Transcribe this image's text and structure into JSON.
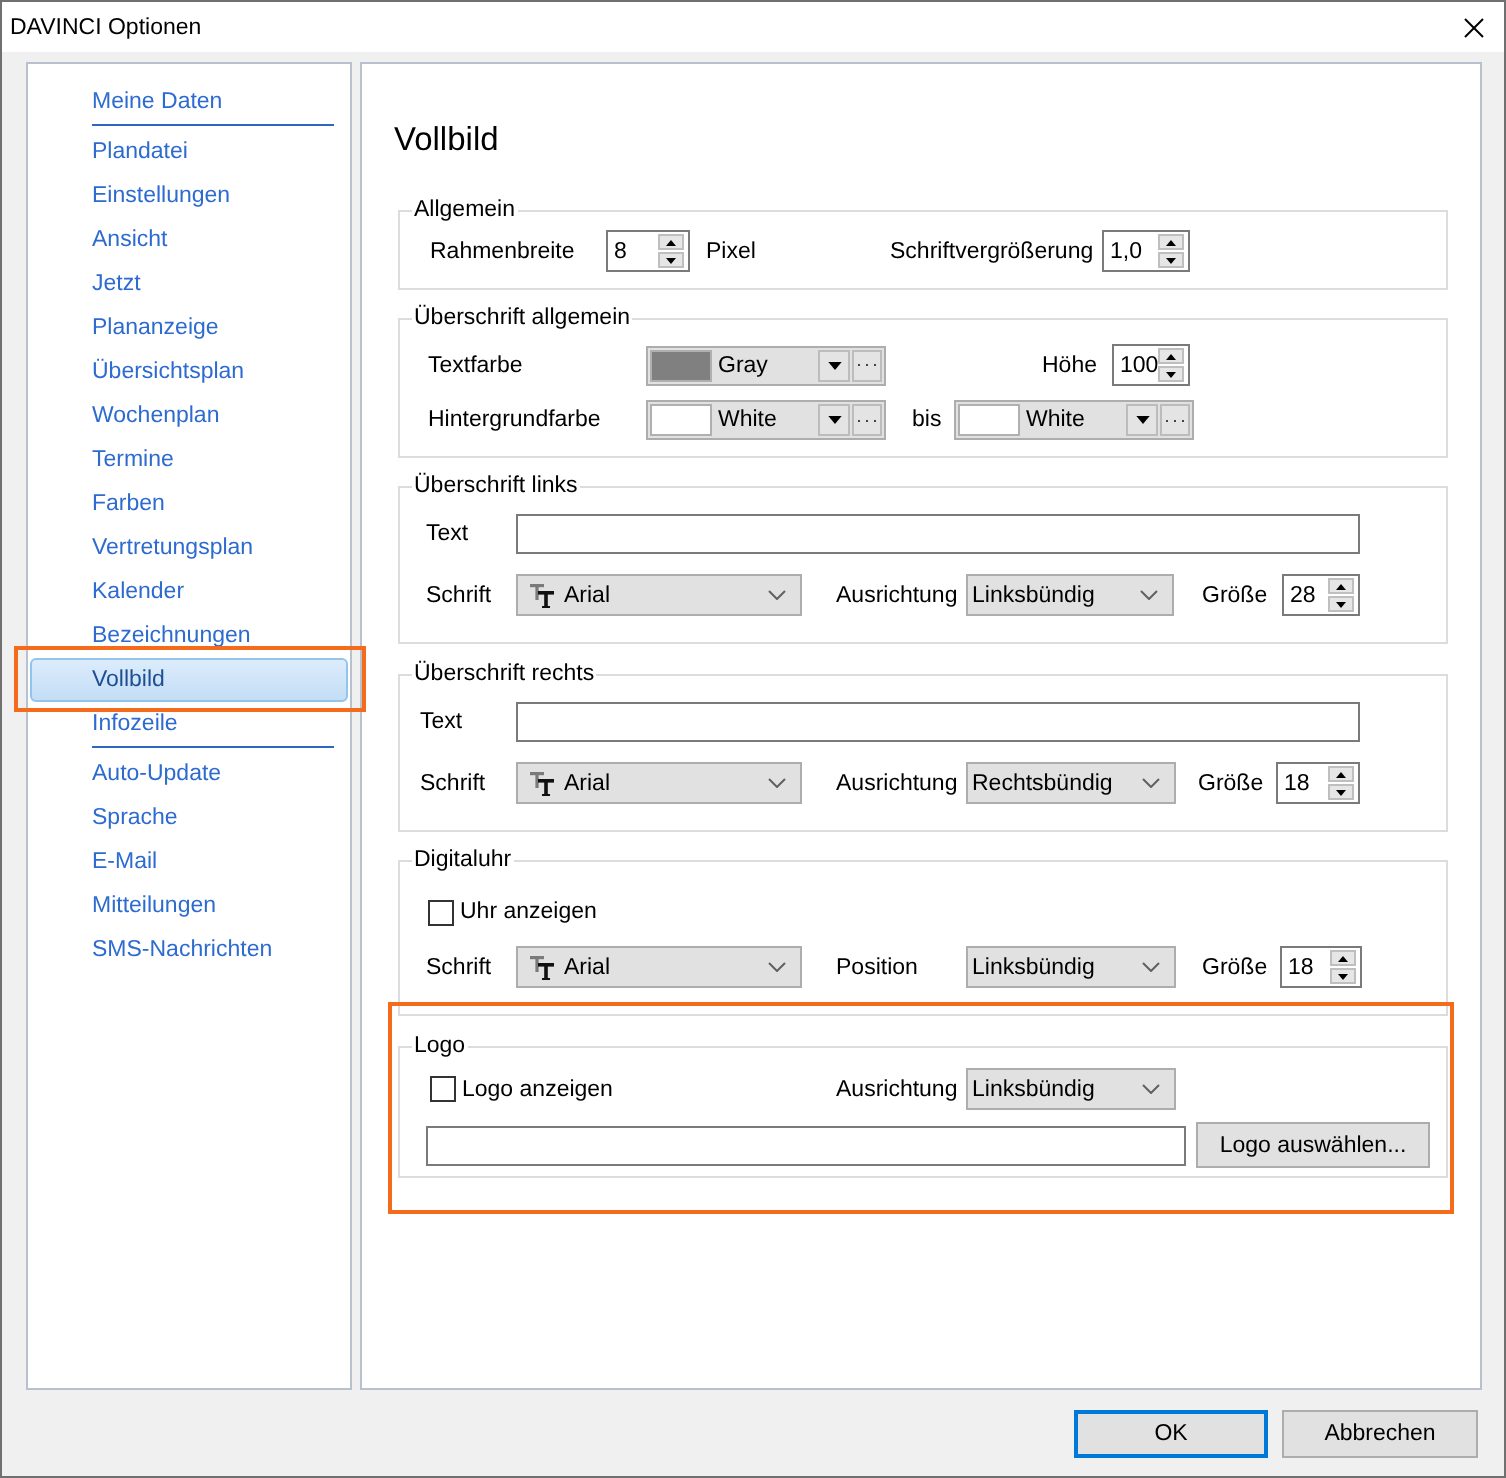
{
  "window": {
    "title": "DAVINCI Optionen"
  },
  "sidebar": {
    "sections": [
      {
        "items": [
          {
            "label": "Meine Daten",
            "selected": false,
            "highlighted": false
          }
        ]
      },
      {
        "items": [
          {
            "label": "Plandatei",
            "selected": false,
            "highlighted": false
          },
          {
            "label": "Einstellungen",
            "selected": false,
            "highlighted": false
          },
          {
            "label": "Ansicht",
            "selected": false,
            "highlighted": false
          },
          {
            "label": "Jetzt",
            "selected": false,
            "highlighted": false
          },
          {
            "label": "Plananzeige",
            "selected": false,
            "highlighted": false
          },
          {
            "label": "Übersichtsplan",
            "selected": false,
            "highlighted": false
          },
          {
            "label": "Wochenplan",
            "selected": false,
            "highlighted": false
          },
          {
            "label": "Termine",
            "selected": false,
            "highlighted": false
          },
          {
            "label": "Farben",
            "selected": false,
            "highlighted": false
          },
          {
            "label": "Vertretungsplan",
            "selected": false,
            "highlighted": false
          },
          {
            "label": "Kalender",
            "selected": false,
            "highlighted": false
          },
          {
            "label": "Bezeichnungen",
            "selected": false,
            "highlighted": false
          },
          {
            "label": "Vollbild",
            "selected": true,
            "highlighted": true
          },
          {
            "label": "Infozeile",
            "selected": false,
            "highlighted": false
          }
        ]
      },
      {
        "items": [
          {
            "label": "Auto-Update",
            "selected": false,
            "highlighted": false
          },
          {
            "label": "Sprache",
            "selected": false,
            "highlighted": false
          },
          {
            "label": "E-Mail",
            "selected": false,
            "highlighted": false
          },
          {
            "label": "Mitteilungen",
            "selected": false,
            "highlighted": false
          },
          {
            "label": "SMS-Nachrichten",
            "selected": false,
            "highlighted": false
          }
        ]
      }
    ]
  },
  "content": {
    "title": "Vollbild",
    "groups": [
      {
        "title": "Allgemein",
        "highlighted": false,
        "lines": [
          {
            "fields": [
              {
                "kind": "label",
                "text": "Rahmenbreite"
              },
              {
                "kind": "spinner",
                "value": "8"
              },
              {
                "kind": "label",
                "text": "Pixel"
              },
              {
                "kind": "label",
                "text": "Schriftvergrößerung"
              },
              {
                "kind": "spinner",
                "value": "1,0"
              }
            ]
          }
        ]
      },
      {
        "title": "Überschrift allgemein",
        "highlighted": false,
        "lines": [
          {
            "fields": [
              {
                "kind": "label",
                "text": "Textfarbe"
              },
              {
                "kind": "color_combo",
                "value": "Gray",
                "color": "#808080"
              },
              {
                "kind": "label",
                "text": "Höhe"
              },
              {
                "kind": "spinner",
                "value": "100"
              }
            ]
          },
          {
            "fields": [
              {
                "kind": "label",
                "text": "Hintergrundfarbe"
              },
              {
                "kind": "color_combo",
                "value": "White",
                "color": "#ffffff"
              },
              {
                "kind": "label",
                "text": "bis"
              },
              {
                "kind": "color_combo",
                "value": "White",
                "color": "#ffffff"
              }
            ]
          }
        ]
      },
      {
        "title": "Überschrift links",
        "highlighted": false,
        "lines": [
          {
            "fields": [
              {
                "kind": "label",
                "text": "Text"
              },
              {
                "kind": "text_input"
              }
            ]
          },
          {
            "fields": [
              {
                "kind": "label",
                "text": "Schrift"
              },
              {
                "kind": "font_combo",
                "value": "Arial"
              },
              {
                "kind": "label",
                "text": "Ausrichtung"
              },
              {
                "kind": "combo",
                "value": "Linksbündig"
              },
              {
                "kind": "label",
                "text": "Größe"
              },
              {
                "kind": "spinner",
                "value": "28"
              }
            ]
          }
        ]
      },
      {
        "title": "Überschrift rechts",
        "highlighted": false,
        "lines": [
          {
            "fields": [
              {
                "kind": "label",
                "text": "Text"
              },
              {
                "kind": "text_input"
              }
            ]
          },
          {
            "fields": [
              {
                "kind": "label",
                "text": "Schrift"
              },
              {
                "kind": "font_combo",
                "value": "Arial"
              },
              {
                "kind": "label",
                "text": "Ausrichtung"
              },
              {
                "kind": "combo",
                "value": "Rechtsbündig"
              },
              {
                "kind": "label",
                "text": "Größe"
              },
              {
                "kind": "spinner",
                "value": "18"
              }
            ]
          }
        ]
      },
      {
        "title": "Digitaluhr",
        "highlighted": false,
        "lines": [
          {
            "fields": [
              {
                "kind": "checkbox",
                "label": "Uhr anzeigen",
                "checked": false
              }
            ]
          },
          {
            "fields": [
              {
                "kind": "label",
                "text": "Schrift"
              },
              {
                "kind": "font_combo",
                "value": "Arial"
              },
              {
                "kind": "label",
                "text": "Position"
              },
              {
                "kind": "combo",
                "value": "Linksbündig"
              },
              {
                "kind": "label",
                "text": "Größe"
              },
              {
                "kind": "spinner",
                "value": "18"
              }
            ]
          }
        ]
      },
      {
        "title": "Logo",
        "highlighted": true,
        "lines": [
          {
            "fields": [
              {
                "kind": "checkbox",
                "label": "Logo anzeigen",
                "checked": false
              },
              {
                "kind": "label",
                "text": "Ausrichtung"
              },
              {
                "kind": "combo",
                "value": "Linksbündig"
              }
            ]
          },
          {
            "fields": [
              {
                "kind": "text_input"
              },
              {
                "kind": "button",
                "label": "Logo auswählen..."
              }
            ]
          }
        ]
      }
    ]
  },
  "buttons": [
    {
      "label": "OK",
      "focused": true
    },
    {
      "label": "Abbrechen",
      "focused": false
    }
  ]
}
